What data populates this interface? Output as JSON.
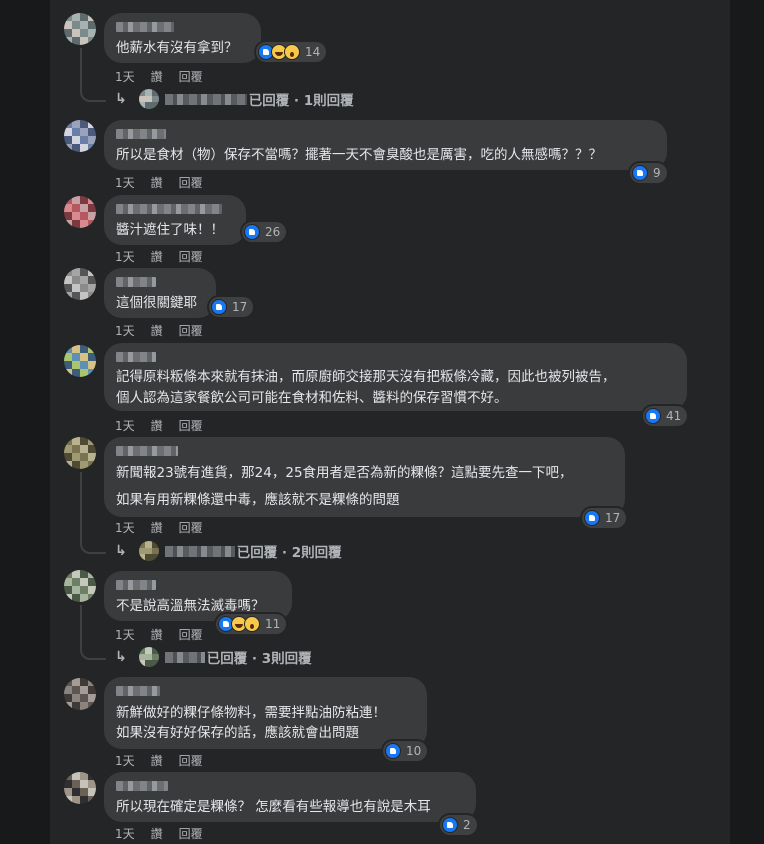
{
  "comments": [
    {
      "text_lines": [
        "他薪水有沒有拿到？"
      ],
      "reactions": 14,
      "reaction_types": [
        "like-icon",
        "haha-icon",
        "wow-icon"
      ],
      "actions": {
        "time": "1天",
        "like": "讚",
        "reply": "回覆"
      },
      "replies": {
        "summary": "已回覆 · 1則回覆"
      },
      "colors": [
        "#7d8a8c",
        "#c9c3bc",
        "#5d6b6f",
        "#a7b3b3"
      ]
    },
    {
      "text_lines": [
        "所以是食材（物）保存不當嗎？擺著一天不會臭酸也是厲害，吃的人無感嗎？？？"
      ],
      "reactions": 9,
      "reaction_types": [
        "like-icon"
      ],
      "actions": {
        "time": "1天",
        "like": "讚",
        "reply": "回覆"
      },
      "colors": [
        "#6a7fa5",
        "#d3d6e0",
        "#4b5a7a",
        "#9aa3bb"
      ]
    },
    {
      "text_lines": [
        "醬汁遮住了味！！"
      ],
      "reactions": 26,
      "reaction_types": [
        "like-icon"
      ],
      "actions": {
        "time": "1天",
        "like": "讚",
        "reply": "回覆"
      },
      "colors": [
        "#b4575f",
        "#d98a8f",
        "#7a3a40",
        "#c9a0a3"
      ]
    },
    {
      "text_lines": [
        "這個很關鍵耶"
      ],
      "reactions": 17,
      "reaction_types": [
        "like-icon"
      ],
      "actions": {
        "time": "1天",
        "like": "讚",
        "reply": "回覆"
      },
      "colors": [
        "#8b8b8b",
        "#c4c4c4",
        "#555555",
        "#a5a5a5"
      ]
    },
    {
      "text_lines": [
        "記得原料粄條本來就有抹油，而原廚師交接那天沒有把粄條冷藏，因此也被列被告，",
        "個人認為這家餐飲公司可能在食材和佐料、醬料的保存習慣不好。"
      ],
      "reactions": 41,
      "reaction_types": [
        "like-icon"
      ],
      "actions": {
        "time": "1天",
        "like": "讚",
        "reply": "回覆"
      },
      "colors": [
        "#5e8fb6",
        "#a9c56e",
        "#3d5d7a",
        "#d6c383"
      ]
    },
    {
      "text_lines": [
        "新聞報23號有進貨，那24，25食用者是否為新的粿條？這點要先查一下吧，",
        "如果有用新粿條還中毒，應該就不是粿條的問題"
      ],
      "reactions": 17,
      "reaction_types": [
        "like-icon"
      ],
      "actions": {
        "time": "1天",
        "like": "讚",
        "reply": "回覆"
      },
      "replies": {
        "summary": "已回覆 · 2則回覆"
      },
      "colors": [
        "#7a7352",
        "#9f9a72",
        "#4e4a33",
        "#b8b38e"
      ]
    },
    {
      "text_lines": [
        "不是說高溫無法滅毒嗎？"
      ],
      "reactions": 11,
      "reaction_types": [
        "like-icon",
        "haha-icon",
        "wow-icon"
      ],
      "actions": {
        "time": "1天",
        "like": "讚",
        "reply": "回覆"
      },
      "replies": {
        "summary": "已回覆 · 3則回覆"
      },
      "colors": [
        "#6d7f66",
        "#a8b59e",
        "#4b5a46",
        "#c4c9bb"
      ]
    },
    {
      "text_lines": [
        "新鮮做好的粿仔條物料，需要拌點油防粘連！",
        "如果沒有好好保存的話，應該就會出問題"
      ],
      "reactions": 10,
      "reaction_types": [
        "like-icon"
      ],
      "actions": {
        "time": "1天",
        "like": "讚",
        "reply": "回覆"
      },
      "colors": [
        "#5c5652",
        "#8a837e",
        "#3e3a37",
        "#a49c96"
      ]
    },
    {
      "text_lines": [
        "所以現在確定是粿條？ 怎麼看有些報導也有說是木耳"
      ],
      "reactions": 2,
      "reaction_types": [
        "like-icon"
      ],
      "actions": {
        "time": "1天",
        "like": "讚",
        "reply": "回覆"
      },
      "colors": [
        "#6b6256",
        "#2f2f33",
        "#9e9488",
        "#c7c2ba"
      ]
    }
  ]
}
